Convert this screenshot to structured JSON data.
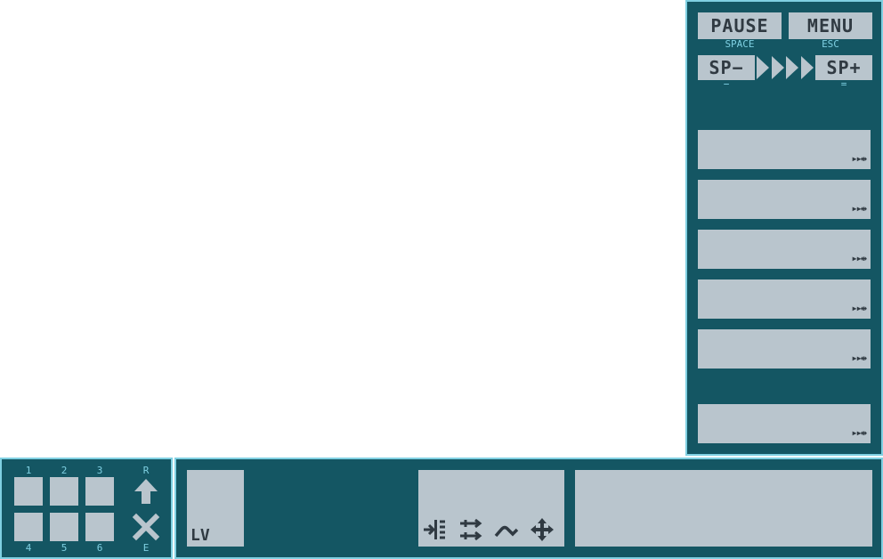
{
  "controls": {
    "pause": {
      "label": "PAUSE",
      "key": "SPACE"
    },
    "menu": {
      "label": "MENU",
      "key": "ESC"
    },
    "speed_down": {
      "label": "SP−",
      "key": "−"
    },
    "speed_up": {
      "label": "SP+",
      "key": "="
    },
    "speed_indicator_icon": "play-triangles-icon"
  },
  "slots": [
    {
      "icons": "▸▸⇹"
    },
    {
      "icons": "▸▸⇹"
    },
    {
      "icons": "▸▸⇹"
    },
    {
      "icons": "▸▸⇹"
    },
    {
      "icons": "▸▸⇹"
    },
    {
      "icons": "▸▸⇹"
    }
  ],
  "inventory": {
    "top_keys": [
      "1",
      "2",
      "3"
    ],
    "bottom_keys": [
      "4",
      "5",
      "6"
    ],
    "up_key": "R",
    "delete_key": "E"
  },
  "bottom": {
    "level_label": "LV",
    "tools": [
      "split-icon",
      "shuffle-icon",
      "curve-icon",
      "move-icon"
    ]
  },
  "colors": {
    "panel": "#145663",
    "panel_border": "#7fd0e2",
    "button": "#b9c5cd",
    "button_text": "#303a42",
    "key_text": "#7fd0e2"
  }
}
